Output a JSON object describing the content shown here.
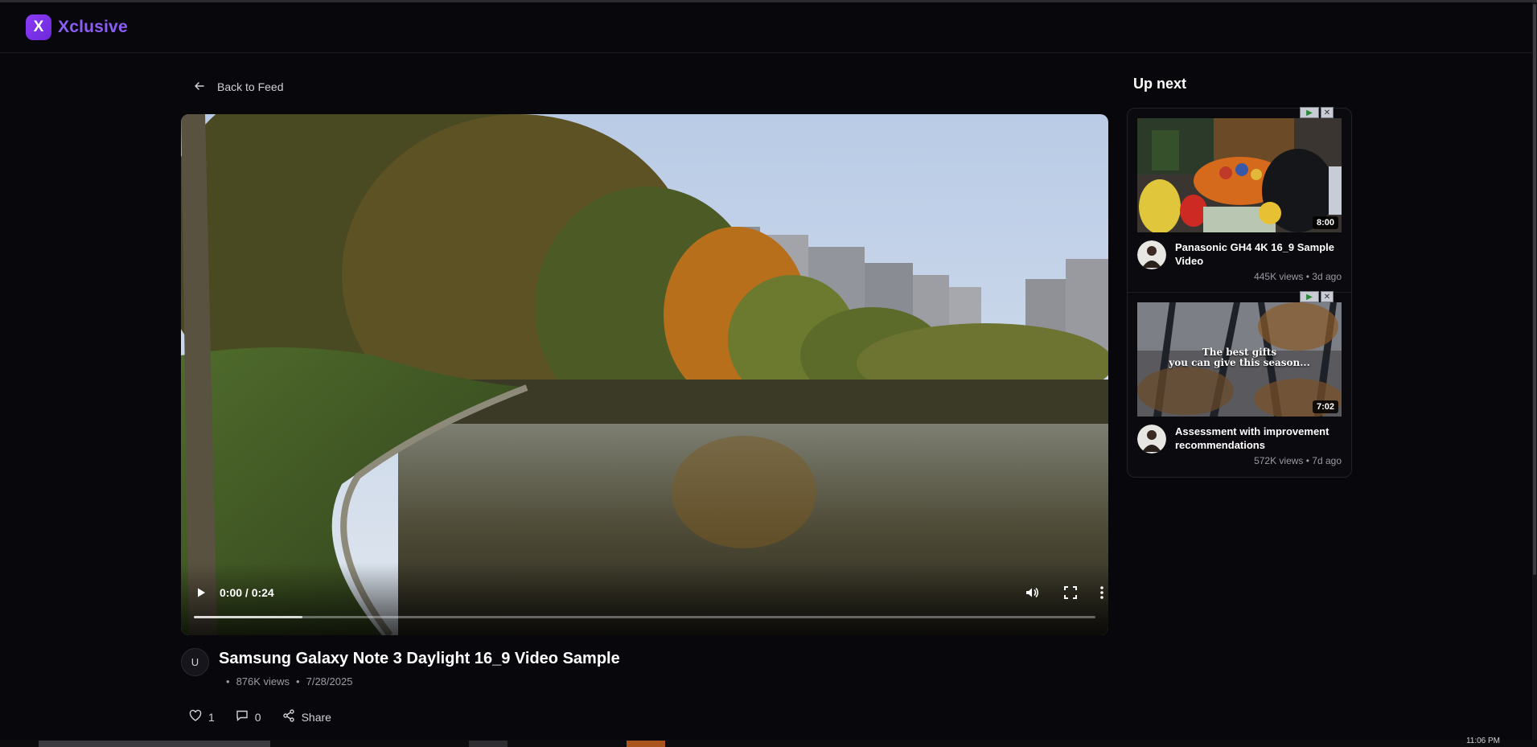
{
  "app": {
    "logo_letter": "X",
    "name": "Xclusive",
    "brand_color": "#8b5cf6"
  },
  "nav": {
    "back_label": "Back to Feed"
  },
  "player": {
    "time_display": "0:00 / 0:24",
    "buffered_fraction": 0.12
  },
  "video": {
    "author_initial": "U",
    "title": "Samsung Galaxy Note 3 Daylight 16_9 Video Sample",
    "views": "876K views",
    "date": "7/28/2025",
    "likes": "1",
    "comments": "0",
    "share_label": "Share"
  },
  "up_next": {
    "title": "Up next",
    "items": [
      {
        "title": "Panasonic GH4 4K 16_9 Sample Video",
        "duration": "8:00",
        "stats": "445K views • 3d ago"
      },
      {
        "title": "Assessment with improvement recommendations",
        "duration": "7:02",
        "stats": "572K views • 7d ago",
        "thumb_caption_1": "The best gifts",
        "thumb_caption_2": "you can give this season..."
      }
    ]
  },
  "ad_badge": {
    "play": "▶",
    "close": "✕"
  },
  "icons": [
    "arrow-left-icon",
    "play-icon",
    "volume-icon",
    "fullscreen-icon",
    "more-vertical-icon",
    "heart-icon",
    "comment-icon",
    "share-icon"
  ],
  "taskbar": {
    "clock": "11:06 PM"
  }
}
